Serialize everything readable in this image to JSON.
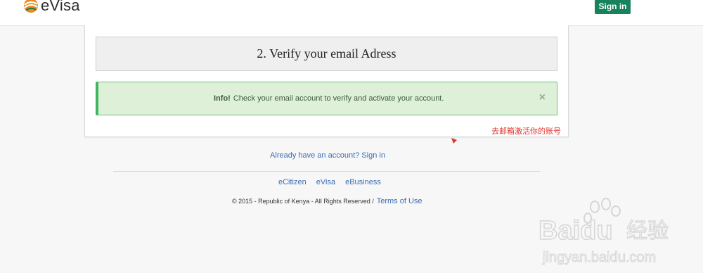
{
  "header": {
    "logo_text": "eVisa",
    "signin_label": "Sign in"
  },
  "verify": {
    "step_title": "2. Verify your email Adress"
  },
  "alert": {
    "label": "Info!",
    "message": "Check your email account to verify and activate your account.",
    "close_glyph": "×"
  },
  "annotation": {
    "text": "去邮箱激活你的账号"
  },
  "account": {
    "prompt": "Already have an account? Sign in"
  },
  "footer": {
    "links": [
      "eCitizen",
      "eVisa",
      "eBusiness"
    ],
    "copyright": "© 2015 - Republic of Kenya - All Rights Reserved /",
    "terms": "Terms of Use"
  },
  "watermark": {
    "brand": "Baidu",
    "suffix": "经验",
    "url": "jingyan.baidu.com"
  },
  "colors": {
    "brand_green": "#18825d",
    "alert_bg": "#dff0d8",
    "alert_border": "#3fb561",
    "link_blue": "#3b6db3",
    "annotation_red": "#e0362d"
  }
}
